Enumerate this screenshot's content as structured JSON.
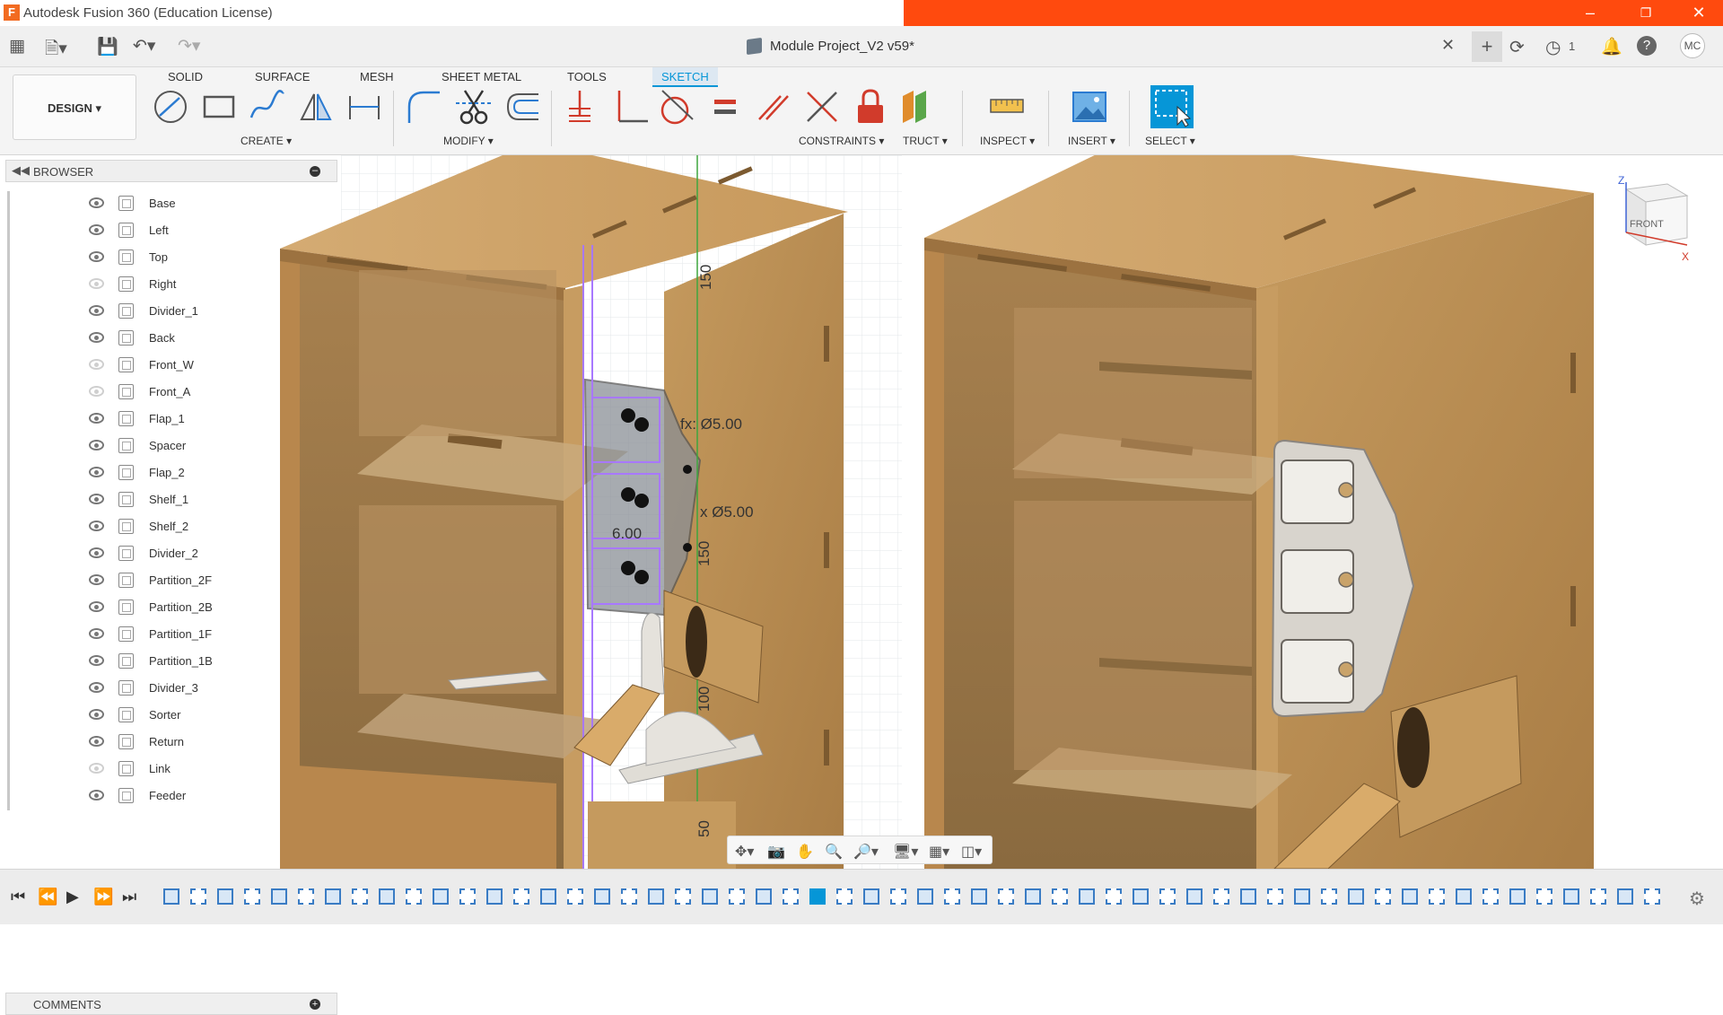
{
  "window": {
    "title": "Autodesk Fusion 360 (Education License)",
    "app_icon": "F",
    "controls": [
      "minimize",
      "restore",
      "close"
    ],
    "accent_color": "#ff4a0e"
  },
  "quick_access": {
    "document_title": "Module Project_V2 v59*",
    "job_count": "1",
    "user_initials": "MC"
  },
  "ribbon": {
    "workspace": "DESIGN",
    "tabs": [
      "SOLID",
      "SURFACE",
      "MESH",
      "SHEET METAL",
      "TOOLS",
      "SKETCH"
    ],
    "active_tab": "SKETCH",
    "groups": {
      "create": "CREATE",
      "modify": "MODIFY",
      "constraints": "CONSTRAINTS",
      "construct": "TRUCT",
      "inspect": "INSPECT",
      "insert": "INSERT",
      "select": "SELECT"
    }
  },
  "browser": {
    "title": "BROWSER",
    "items": [
      {
        "name": "Base",
        "visible": true
      },
      {
        "name": "Left",
        "visible": true
      },
      {
        "name": "Top",
        "visible": true
      },
      {
        "name": "Right",
        "visible": false
      },
      {
        "name": "Divider_1",
        "visible": true
      },
      {
        "name": "Back",
        "visible": true
      },
      {
        "name": "Front_W",
        "visible": false
      },
      {
        "name": "Front_A",
        "visible": false
      },
      {
        "name": "Flap_1",
        "visible": true
      },
      {
        "name": "Spacer",
        "visible": true
      },
      {
        "name": "Flap_2",
        "visible": true
      },
      {
        "name": "Shelf_1",
        "visible": true
      },
      {
        "name": "Shelf_2",
        "visible": true
      },
      {
        "name": "Divider_2",
        "visible": true
      },
      {
        "name": "Partition_2F",
        "visible": true
      },
      {
        "name": "Partition_2B",
        "visible": true
      },
      {
        "name": "Partition_1F",
        "visible": true
      },
      {
        "name": "Partition_1B",
        "visible": true
      },
      {
        "name": "Divider_3",
        "visible": true
      },
      {
        "name": "Sorter",
        "visible": true
      },
      {
        "name": "Return",
        "visible": true
      },
      {
        "name": "Link",
        "visible": false
      },
      {
        "name": "Feeder",
        "visible": true
      }
    ],
    "comments_label": "COMMENTS"
  },
  "viewport": {
    "dimensions": {
      "dia_top": "fx: Ø5.00",
      "dia_mid": "x Ø5.00",
      "len_mid": "6.00",
      "ruler_150_top": "150",
      "ruler_150": "150",
      "ruler_100": "100",
      "ruler_50": "50"
    },
    "viewcube_label": "FRONT",
    "axis_z": "Z",
    "axis_x": "X"
  }
}
